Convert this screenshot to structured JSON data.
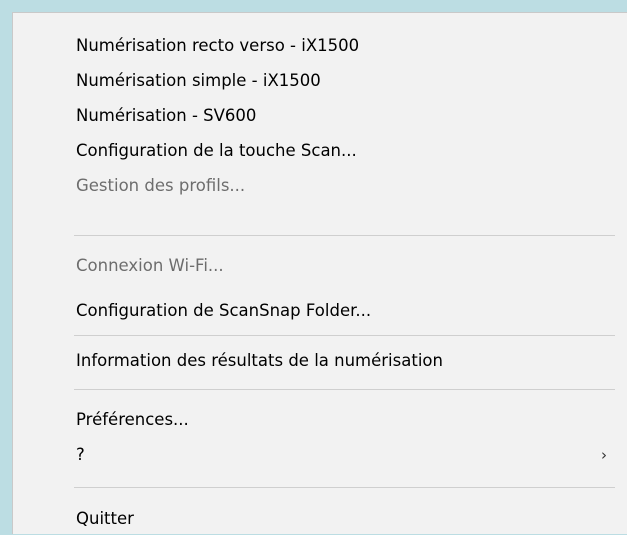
{
  "menu": {
    "items": [
      {
        "label": "Numérisation recto verso - iX1500",
        "enabled": true
      },
      {
        "label": "Numérisation simple - iX1500",
        "enabled": true
      },
      {
        "label": "Numérisation - SV600",
        "enabled": true
      },
      {
        "label": "Configuration de la touche Scan...",
        "enabled": true
      },
      {
        "label": "Gestion des profils...",
        "enabled": false
      },
      {
        "label": "Connexion Wi-Fi...",
        "enabled": false
      },
      {
        "label": "Configuration de ScanSnap Folder...",
        "enabled": true
      },
      {
        "label": "Information des résultats de la numérisation",
        "enabled": true
      },
      {
        "label": "Préférences...",
        "enabled": true
      },
      {
        "label": "?",
        "enabled": true,
        "submenu": true
      },
      {
        "label": "Quitter",
        "enabled": true
      }
    ],
    "submenu_arrow": "›",
    "submenu_icon": "chevron-right-icon"
  }
}
